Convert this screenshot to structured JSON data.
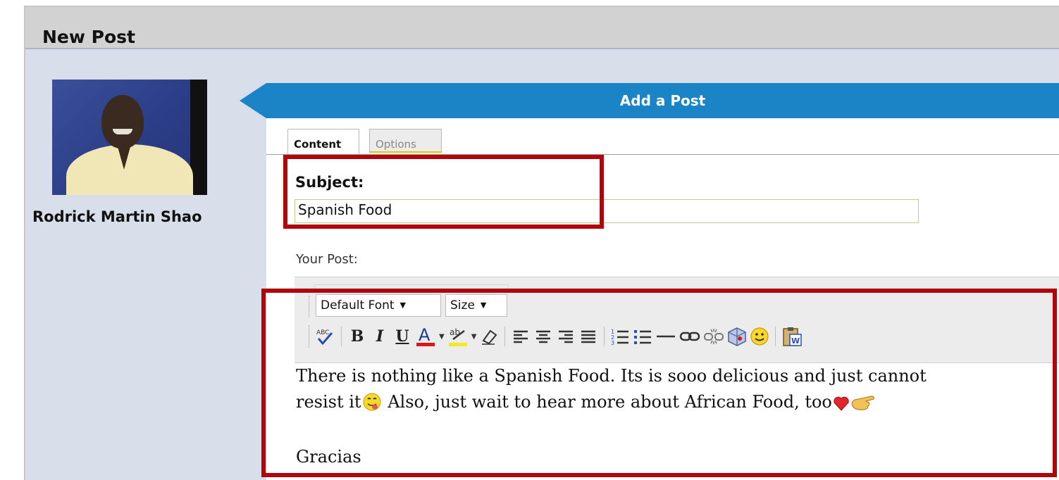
{
  "window": {
    "title": "New Post"
  },
  "author": {
    "name": "Rodrick Martin Shao",
    "avatar": "author-photo"
  },
  "form": {
    "header": "Add a Post",
    "tabs": [
      {
        "label": "Content",
        "active": true
      },
      {
        "label": "Options",
        "active": false
      }
    ],
    "subject_label": "Subject:",
    "subject_value": "Spanish Food",
    "post_label": "Your Post:"
  },
  "editor": {
    "font_select": "Default Font",
    "size_select": "Size",
    "toolbar_icons": [
      "spellcheck-icon",
      "bold-icon",
      "italic-icon",
      "underline-icon",
      "font-color-icon",
      "highlight-icon",
      "eraser-icon",
      "align-left-icon",
      "align-center-icon",
      "align-right-icon",
      "justify-icon",
      "ordered-list-icon",
      "unordered-list-icon",
      "horizontal-rule-icon",
      "link-icon",
      "unlink-icon",
      "media-icon",
      "smiley-icon",
      "paste-word-icon"
    ],
    "body_line1": "There is nothing like a Spanish Food. Its is sooo delicious and just cannot",
    "body_line2_a": "resist it",
    "body_line2_b": " Also, just wait to hear more about African Food, too",
    "body_line4": "Gracias"
  },
  "colors": {
    "header_blue": "#1b84c6",
    "highlight_red": "#b0050b",
    "panel_bg": "#d8dfea"
  }
}
